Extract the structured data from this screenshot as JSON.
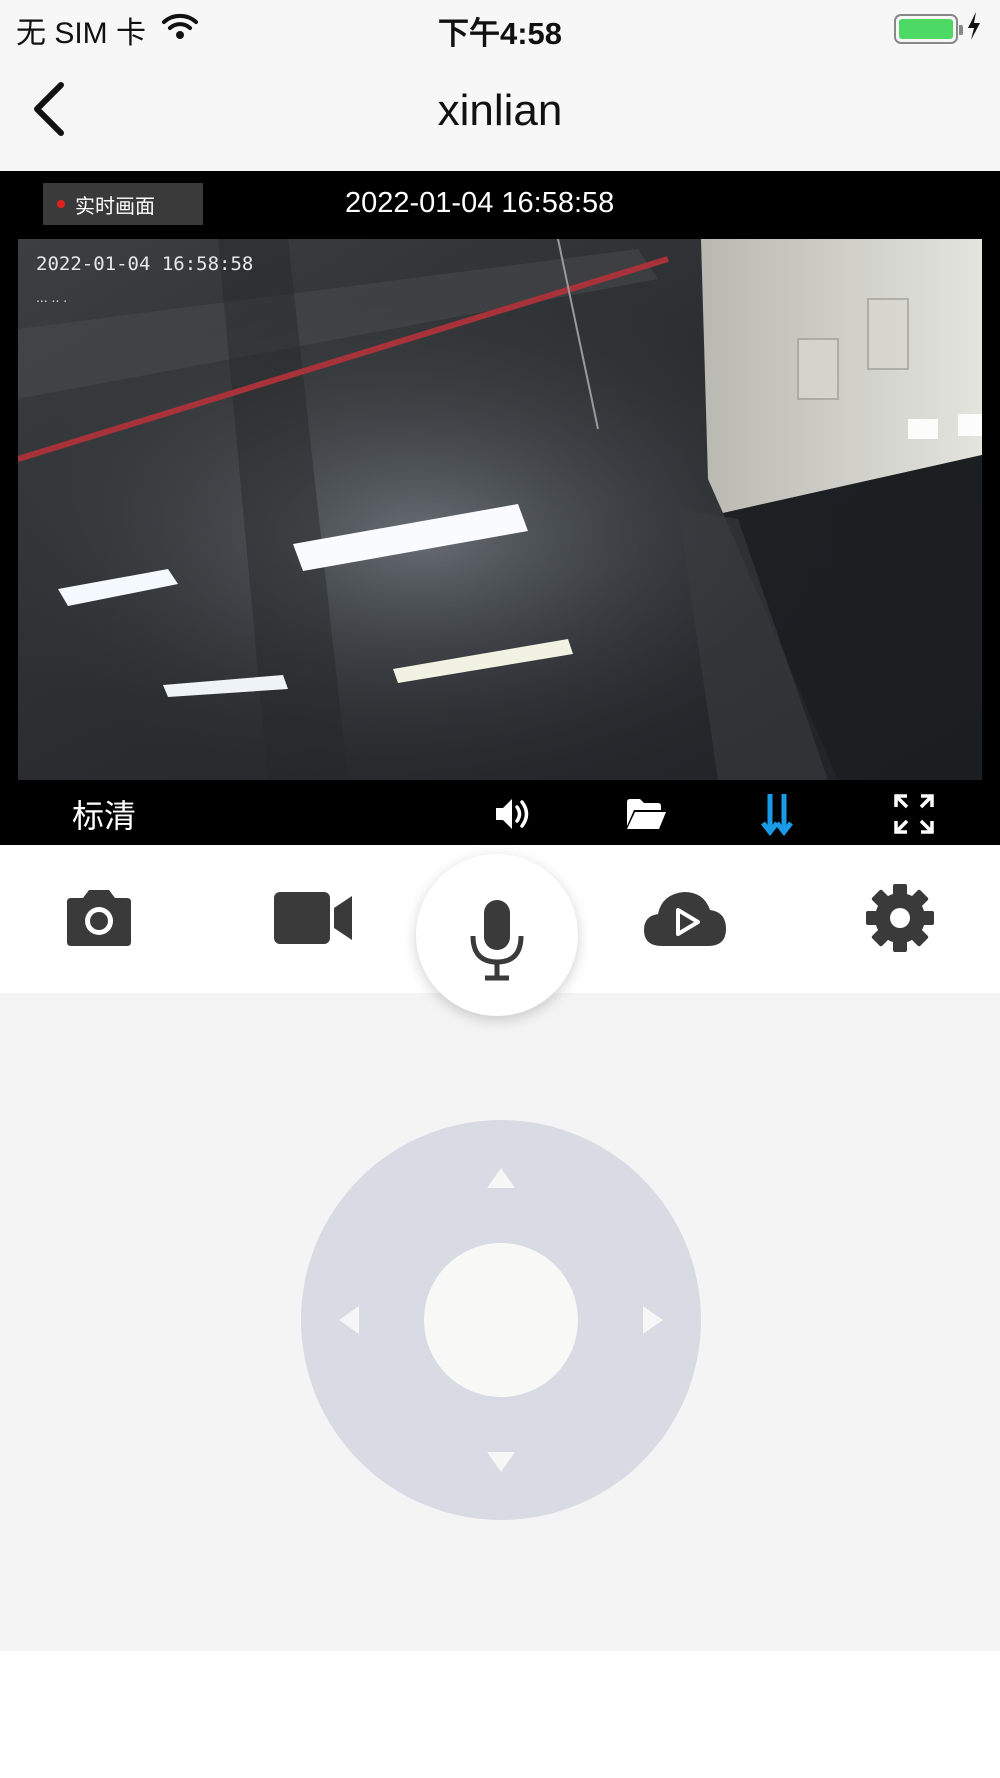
{
  "status_bar": {
    "carrier": "无 SIM 卡",
    "time": "下午4:58",
    "battery_color": "#4cd964",
    "icons": [
      "wifi-icon",
      "battery-icon",
      "charging-bolt-icon"
    ]
  },
  "nav": {
    "title": "xinlian",
    "back_icon": "chevron-left-icon"
  },
  "video": {
    "live_label": "实时画面",
    "timestamp": "2022-01-04 16:58:58",
    "osd_timestamp": "2022-01-04  16:58:58",
    "osd_sub": "... .. .",
    "quality_label": "标清",
    "toolbar_icons": [
      "speaker-icon",
      "folder-icon",
      "stream-arrows-icon",
      "fullscreen-icon"
    ],
    "accent_color": "#1a9be8"
  },
  "actions": {
    "icons": [
      "camera-icon",
      "video-record-icon",
      "microphone-icon",
      "cloud-play-icon",
      "settings-gear-icon"
    ]
  },
  "ptz": {
    "pad_color": "#d8dbe4",
    "directions": [
      "up",
      "down",
      "left",
      "right"
    ]
  }
}
